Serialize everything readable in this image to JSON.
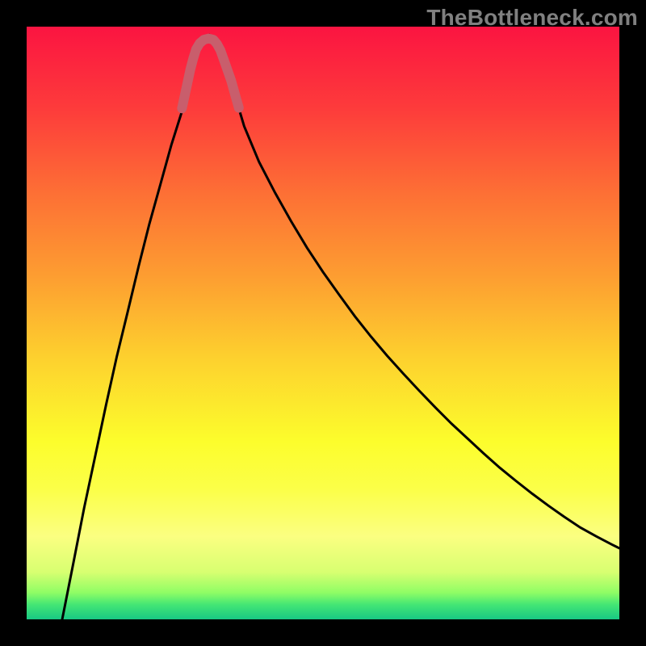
{
  "watermark": {
    "text": "TheBottleneck.com"
  },
  "chart_data": {
    "type": "line",
    "title": "",
    "xlabel": "",
    "ylabel": "",
    "xlim": [
      0,
      1
    ],
    "ylim": [
      0,
      1
    ],
    "background_gradient": {
      "stops": [
        {
          "offset": 0.0,
          "color": "#fb1441"
        },
        {
          "offset": 0.14,
          "color": "#fd3c3b"
        },
        {
          "offset": 0.28,
          "color": "#fd6f35"
        },
        {
          "offset": 0.42,
          "color": "#fd9d31"
        },
        {
          "offset": 0.56,
          "color": "#fdd12e"
        },
        {
          "offset": 0.7,
          "color": "#fcfd2c"
        },
        {
          "offset": 0.78,
          "color": "#fbff48"
        },
        {
          "offset": 0.86,
          "color": "#fbff81"
        },
        {
          "offset": 0.92,
          "color": "#d8ff71"
        },
        {
          "offset": 0.955,
          "color": "#8ffd65"
        },
        {
          "offset": 0.975,
          "color": "#44e674"
        },
        {
          "offset": 1.0,
          "color": "#18c884"
        }
      ]
    },
    "series": [
      {
        "name": "v-curve",
        "stroke": "#000000",
        "stroke_width": 3,
        "points_xy": [
          [
            0.06,
            0.0
          ],
          [
            0.079,
            0.096
          ],
          [
            0.097,
            0.188
          ],
          [
            0.116,
            0.277
          ],
          [
            0.134,
            0.362
          ],
          [
            0.152,
            0.443
          ],
          [
            0.171,
            0.521
          ],
          [
            0.189,
            0.596
          ],
          [
            0.207,
            0.667
          ],
          [
            0.226,
            0.735
          ],
          [
            0.244,
            0.8
          ],
          [
            0.262,
            0.857
          ],
          [
            0.272,
            0.902
          ],
          [
            0.28,
            0.935
          ],
          [
            0.287,
            0.96
          ],
          [
            0.293,
            0.975
          ],
          [
            0.3,
            0.983
          ],
          [
            0.308,
            0.986
          ],
          [
            0.316,
            0.983
          ],
          [
            0.322,
            0.976
          ],
          [
            0.329,
            0.962
          ],
          [
            0.336,
            0.94
          ],
          [
            0.344,
            0.912
          ],
          [
            0.355,
            0.872
          ],
          [
            0.367,
            0.832
          ],
          [
            0.392,
            0.772
          ],
          [
            0.419,
            0.72
          ],
          [
            0.446,
            0.672
          ],
          [
            0.473,
            0.627
          ],
          [
            0.5,
            0.586
          ],
          [
            0.527,
            0.548
          ],
          [
            0.554,
            0.511
          ],
          [
            0.581,
            0.477
          ],
          [
            0.608,
            0.445
          ],
          [
            0.636,
            0.414
          ],
          [
            0.663,
            0.385
          ],
          [
            0.69,
            0.357
          ],
          [
            0.717,
            0.33
          ],
          [
            0.744,
            0.305
          ],
          [
            0.771,
            0.28
          ],
          [
            0.798,
            0.256
          ],
          [
            0.825,
            0.234
          ],
          [
            0.853,
            0.212
          ],
          [
            0.88,
            0.192
          ],
          [
            0.907,
            0.173
          ],
          [
            0.934,
            0.155
          ],
          [
            0.961,
            0.14
          ],
          [
            0.988,
            0.126
          ],
          [
            1.0,
            0.12
          ]
        ]
      },
      {
        "name": "trough-marker",
        "stroke": "#c85e6c",
        "stroke_width": 12,
        "linecap": "round",
        "points_xy": [
          [
            0.262,
            0.862
          ],
          [
            0.27,
            0.899
          ],
          [
            0.276,
            0.927
          ],
          [
            0.281,
            0.946
          ],
          [
            0.286,
            0.962
          ],
          [
            0.292,
            0.972
          ],
          [
            0.299,
            0.978
          ],
          [
            0.307,
            0.98
          ],
          [
            0.315,
            0.978
          ],
          [
            0.321,
            0.971
          ],
          [
            0.327,
            0.96
          ],
          [
            0.332,
            0.946
          ],
          [
            0.338,
            0.929
          ],
          [
            0.345,
            0.909
          ],
          [
            0.352,
            0.884
          ],
          [
            0.358,
            0.863
          ]
        ]
      }
    ]
  }
}
